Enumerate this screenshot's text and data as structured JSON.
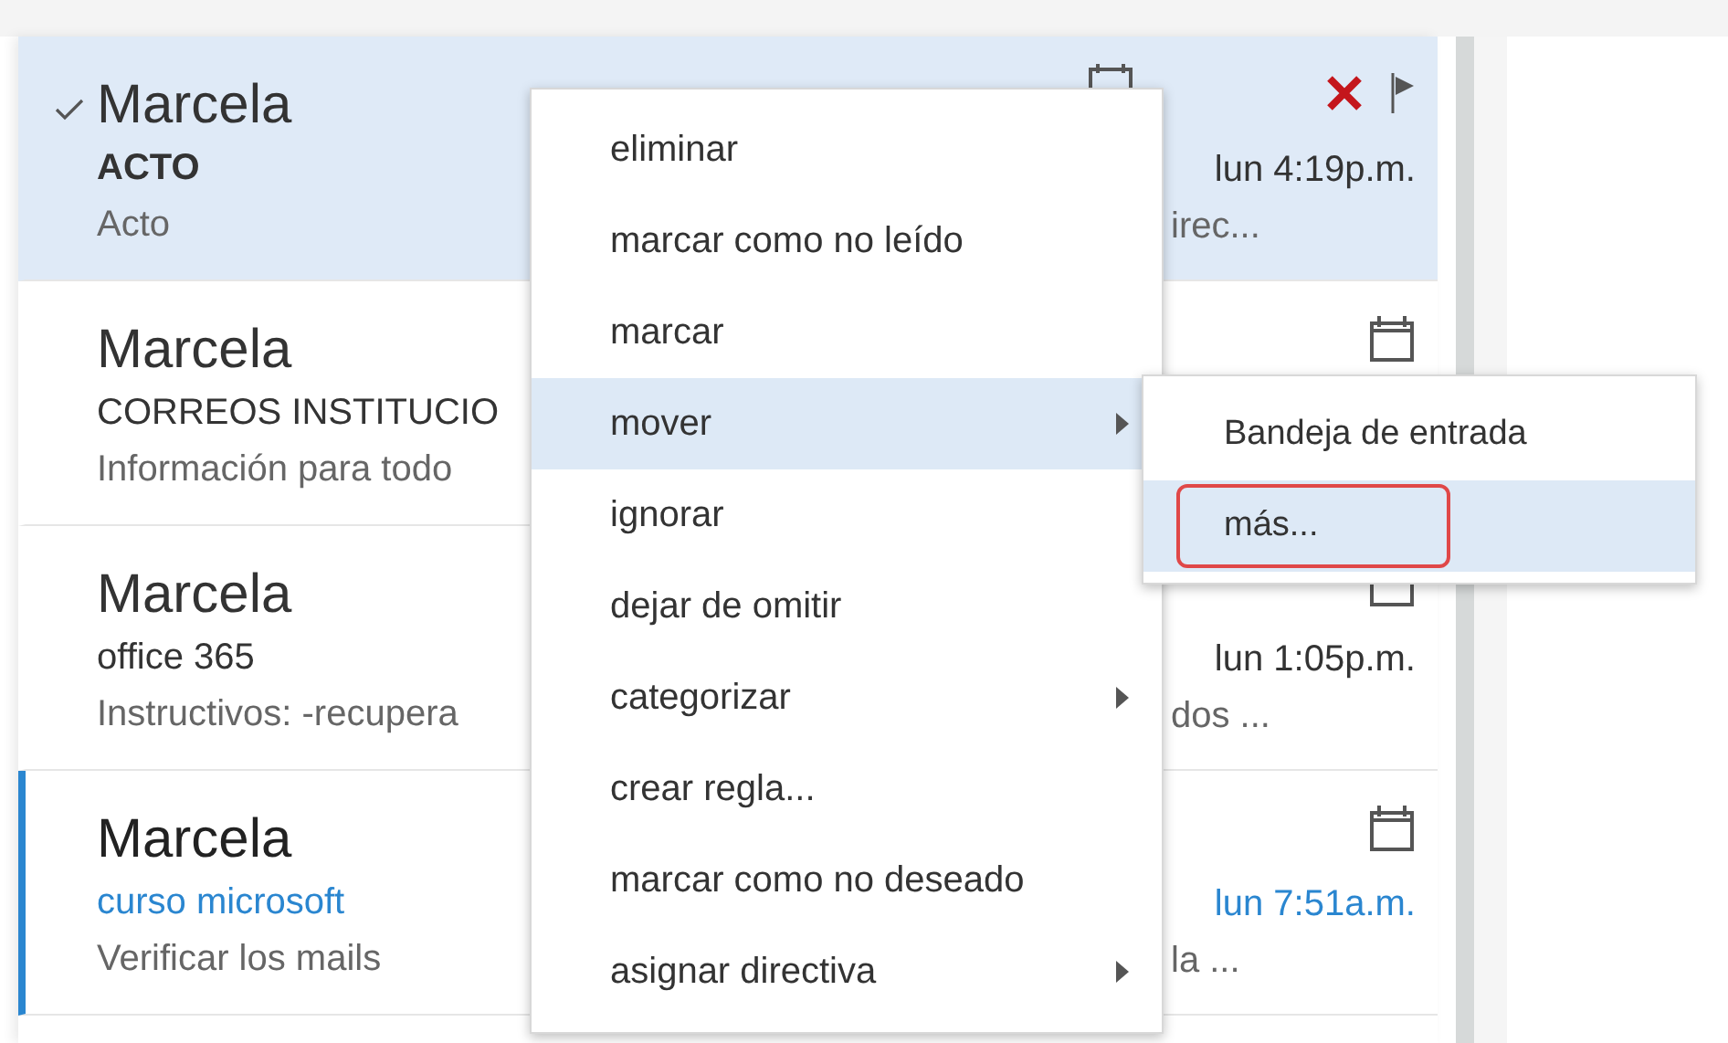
{
  "messages": [
    {
      "sender": "Marcela",
      "subject": "ACTO",
      "preview": "Acto",
      "preview_end": "irec...",
      "time": "lun 4:19p.m.",
      "selected": true,
      "unread": false,
      "actions": true
    },
    {
      "sender": "Marcela",
      "subject": "CORREOS INSTITUCIO",
      "preview": "Información para todo",
      "selected": false,
      "unread": false,
      "actions": false
    },
    {
      "sender": "Marcela",
      "subject": "office 365",
      "preview": "Instructivos:  -recupera",
      "preview_end": "dos ...",
      "time": "lun 1:05p.m.",
      "selected": false,
      "unread": false,
      "actions": false
    },
    {
      "sender": "Marcela",
      "subject": "curso microsoft",
      "preview": "Verificar los mails",
      "preview_end": "la ...",
      "time": "lun 7:51a.m.",
      "selected": false,
      "unread": true,
      "actions": false
    }
  ],
  "context_menu": [
    {
      "label": "eliminar",
      "selected": false,
      "submenu": false
    },
    {
      "label": "marcar como no leído",
      "selected": false,
      "submenu": false
    },
    {
      "label": "marcar",
      "selected": false,
      "submenu": false
    },
    {
      "label": "mover",
      "selected": true,
      "submenu": true
    },
    {
      "label": "ignorar",
      "selected": false,
      "submenu": false
    },
    {
      "label": "dejar de omitir",
      "selected": false,
      "submenu": false
    },
    {
      "label": "categorizar",
      "selected": false,
      "submenu": true
    },
    {
      "label": "crear regla...",
      "selected": false,
      "submenu": false
    },
    {
      "label": "marcar como no deseado",
      "selected": false,
      "submenu": false
    },
    {
      "label": "asignar directiva",
      "selected": false,
      "submenu": true
    }
  ],
  "submenu": [
    {
      "label": "Bandeja de entrada",
      "selected": false,
      "highlighted": false
    },
    {
      "label": "más...",
      "selected": true,
      "highlighted": true
    }
  ]
}
